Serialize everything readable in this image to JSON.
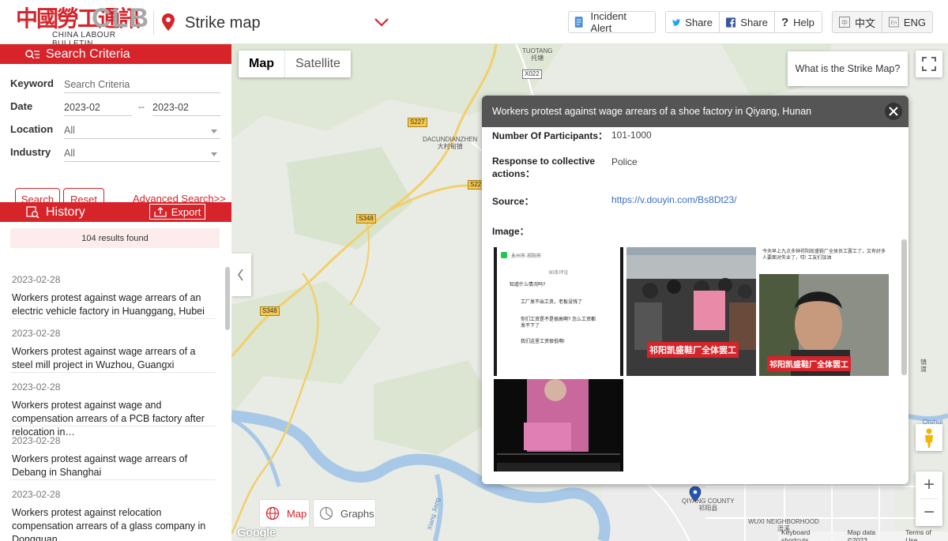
{
  "header": {
    "logo_cn": "中國勞工通訊",
    "logo_en": "CLB",
    "logo_sub": "CHINA LABOUR BULLETIN",
    "title": "Strike map",
    "incident_alert": "Incident Alert",
    "share_twitter": "Share",
    "share_facebook": "Share",
    "help": "Help",
    "lang_cn": "中文",
    "lang_en": "ENG",
    "colors": {
      "brand": "#d6242a",
      "twitter": "#1da1f2",
      "facebook": "#3b5998"
    }
  },
  "sidebar": {
    "search_title": "Search Criteria",
    "keyword_label": "Keyword",
    "keyword_placeholder": "Search Criteria",
    "date_label": "Date",
    "date_from": "2023-02",
    "date_sep": "--",
    "date_to": "2023-02",
    "location_label": "Location",
    "location_value": "All",
    "industry_label": "Industry",
    "industry_value": "All",
    "search_btn": "Search",
    "reset_btn": "Reset",
    "advanced": "Advanced Search>>",
    "history_title": "History",
    "export": "Export",
    "results": "104 results found",
    "items": [
      {
        "date": "2023-02-28",
        "title": "Workers protest against wage arrears of an electric vehicle factory in Huanggang, Hubei"
      },
      {
        "date": "2023-02-28",
        "title": "Workers protest against wage arrears of a steel mill project in Wuzhou, Guangxi"
      },
      {
        "date": "2023-02-28",
        "title": "Workers protest against wage and compensation arrears of a PCB factory after relocation in…"
      },
      {
        "date": "2023-02-28",
        "title": "Workers protest against wage arrears of Debang in Shanghai"
      },
      {
        "date": "2023-02-28",
        "title": "Workers protest against relocation compensation arrears of a glass company in Dongguan,…"
      }
    ]
  },
  "map": {
    "type_map": "Map",
    "type_satellite": "Satellite",
    "what_is": "What is the Strike Map?",
    "bottom_map": "Map",
    "bottom_graphs": "Graphs",
    "google": "Google",
    "attrib_shortcuts": "Keyboard shortcuts",
    "attrib_data": "Map data ©2023",
    "attrib_terms": "Terms of Use",
    "labels": {
      "tuotang": "TUOTANG",
      "tuotang_cn": "托塘",
      "x022": "X022",
      "s227a": "S227",
      "s227b": "S227",
      "dacun": "DACUNDIANZHEN",
      "dacun_cn": "大村甸镇",
      "s348a": "S348",
      "s348b": "S348",
      "qiyang": "QIYANG COUNTY",
      "qiyang_cn": "祁阳县",
      "wuxi": "WUXI NEIGHBORHOOD",
      "wuxi_cn": "浯溪",
      "xiangjiang": "Xiang Jiang",
      "qishui": "Qishui Riv",
      "right_cn": "镇 渡"
    }
  },
  "infowindow": {
    "title": "Workers protest against wage arrears of a shoe factory in Qiyang, Hunan",
    "participants_label": "Number Of Participants：",
    "participants_value": "101-1000",
    "response_label": "Response to collective actions：",
    "response_value": "Police",
    "source_label": "Source：",
    "source_value": "https://v.douyin.com/Bs8Dt23/",
    "image_label": "Image：",
    "thumb1_header": "永州市·祁阳市",
    "thumb1_count": "90条评论",
    "thumb1_lines": [
      "知道什么情况吗?",
      "工厂发不出工资，老板没钱了",
      "你们工资是不是很高啊? 怎么工资都发不下了",
      "我们这里工资很低啊!"
    ],
    "thumb2_banner": "祁阳凯盛鞋厂全体罢工",
    "thumb3_caption": "今天早上九点多钟祁阳凯盛鞋厂全体员工罢工了，又有好多人要面对失业了，哎! 工友们加油",
    "thumb3_banner": "祁阳凯盛鞋厂全体罢工"
  }
}
